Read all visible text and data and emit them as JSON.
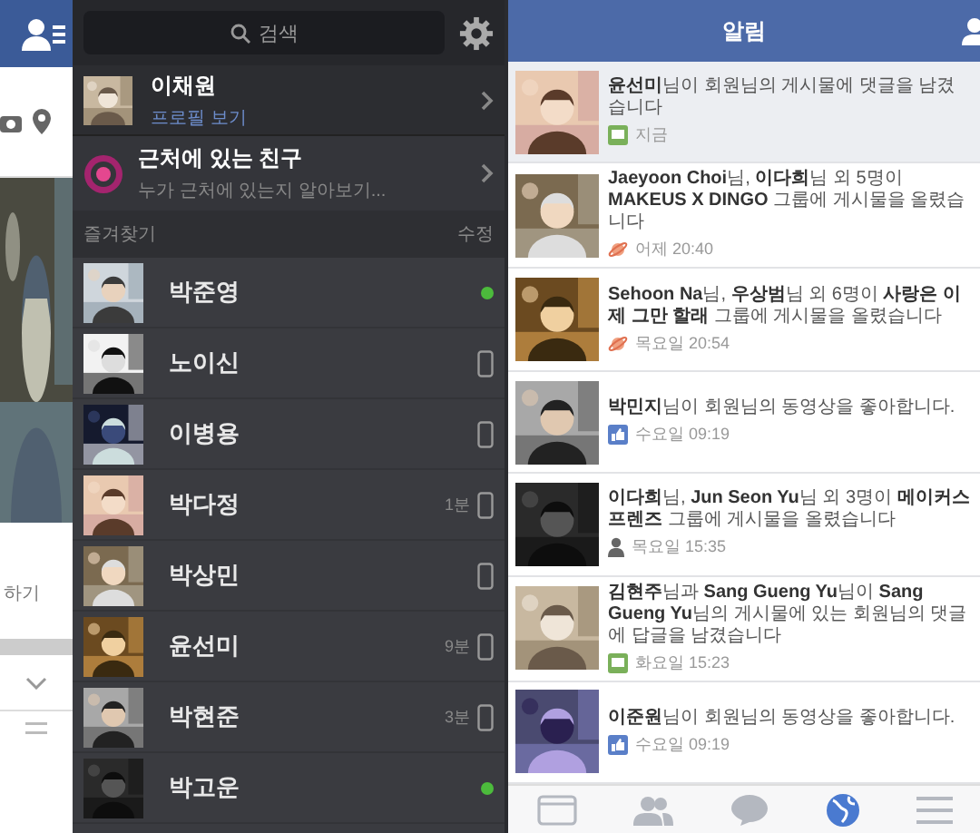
{
  "left_panel": {
    "action_text": "하기"
  },
  "menu": {
    "search": {
      "placeholder": "검색"
    },
    "profile": {
      "name": "이채원",
      "link": "프로필 보기"
    },
    "nearby": {
      "title": "근처에 있는 친구",
      "subtitle": "누가 근처에 있는지 알아보기..."
    },
    "section": {
      "title": "즐겨찾기",
      "action": "수정"
    },
    "friends": [
      {
        "name": "박준영",
        "kind": "online"
      },
      {
        "name": "노이신",
        "kind": "mobile"
      },
      {
        "name": "이병용",
        "kind": "mobile"
      },
      {
        "name": "박다정",
        "kind": "mobile",
        "time": "1분"
      },
      {
        "name": "박상민",
        "kind": "mobile"
      },
      {
        "name": "윤선미",
        "kind": "mobile",
        "time": "9분"
      },
      {
        "name": "박현준",
        "kind": "mobile",
        "time": "3분"
      },
      {
        "name": "박고운",
        "kind": "online"
      }
    ]
  },
  "notifications_panel": {
    "title": "알림",
    "notifications": [
      {
        "text": "**윤선미**님이 회원님의 게시물에 댓글을 남겼습니다",
        "kind": "comment",
        "time": "지금",
        "unread": true
      },
      {
        "text": "**Jaeyoon Choi**님, **이다희**님 외 5명이 **MAKEUS X DINGO** 그룹에 게시물을 올렸습니다",
        "kind": "group",
        "time": "어제 20:40",
        "unread": false
      },
      {
        "text": "**Sehoon Na**님, **우상범**님 외 6명이 **사랑은 이제 그만 할래** 그룹에 게시물을 올렸습니다",
        "kind": "group",
        "time": "목요일 20:54",
        "unread": false
      },
      {
        "text": "**박민지**님이 회원님의 동영상을 좋아합니다.",
        "kind": "like",
        "time": "수요일 09:19",
        "unread": false
      },
      {
        "text": "**이다희**님, **Jun Seon Yu**님 외 3명이 **메이커스 프렌즈** 그룹에 게시물을 올렸습니다",
        "kind": "person",
        "time": "목요일 15:35",
        "unread": false
      },
      {
        "text": "**김현주**님과 **Sang Gueng Yu**님이 **Sang Gueng Yu**님의 게시물에 있는 회원님의 댓글에 답글을 남겼습니다",
        "kind": "comment",
        "time": "화요일 15:23",
        "unread": false
      },
      {
        "text": "**이준원**님이 회원님의 동영상을 좋아합니다.",
        "kind": "like",
        "time": "수요일 09:19",
        "unread": false
      }
    ],
    "tab_bar": [
      {
        "kind": "news-feed",
        "selected": false
      },
      {
        "kind": "friends",
        "selected": false
      },
      {
        "kind": "messages",
        "selected": false
      },
      {
        "kind": "notifications",
        "selected": true
      },
      {
        "kind": "more",
        "selected": false
      }
    ]
  }
}
